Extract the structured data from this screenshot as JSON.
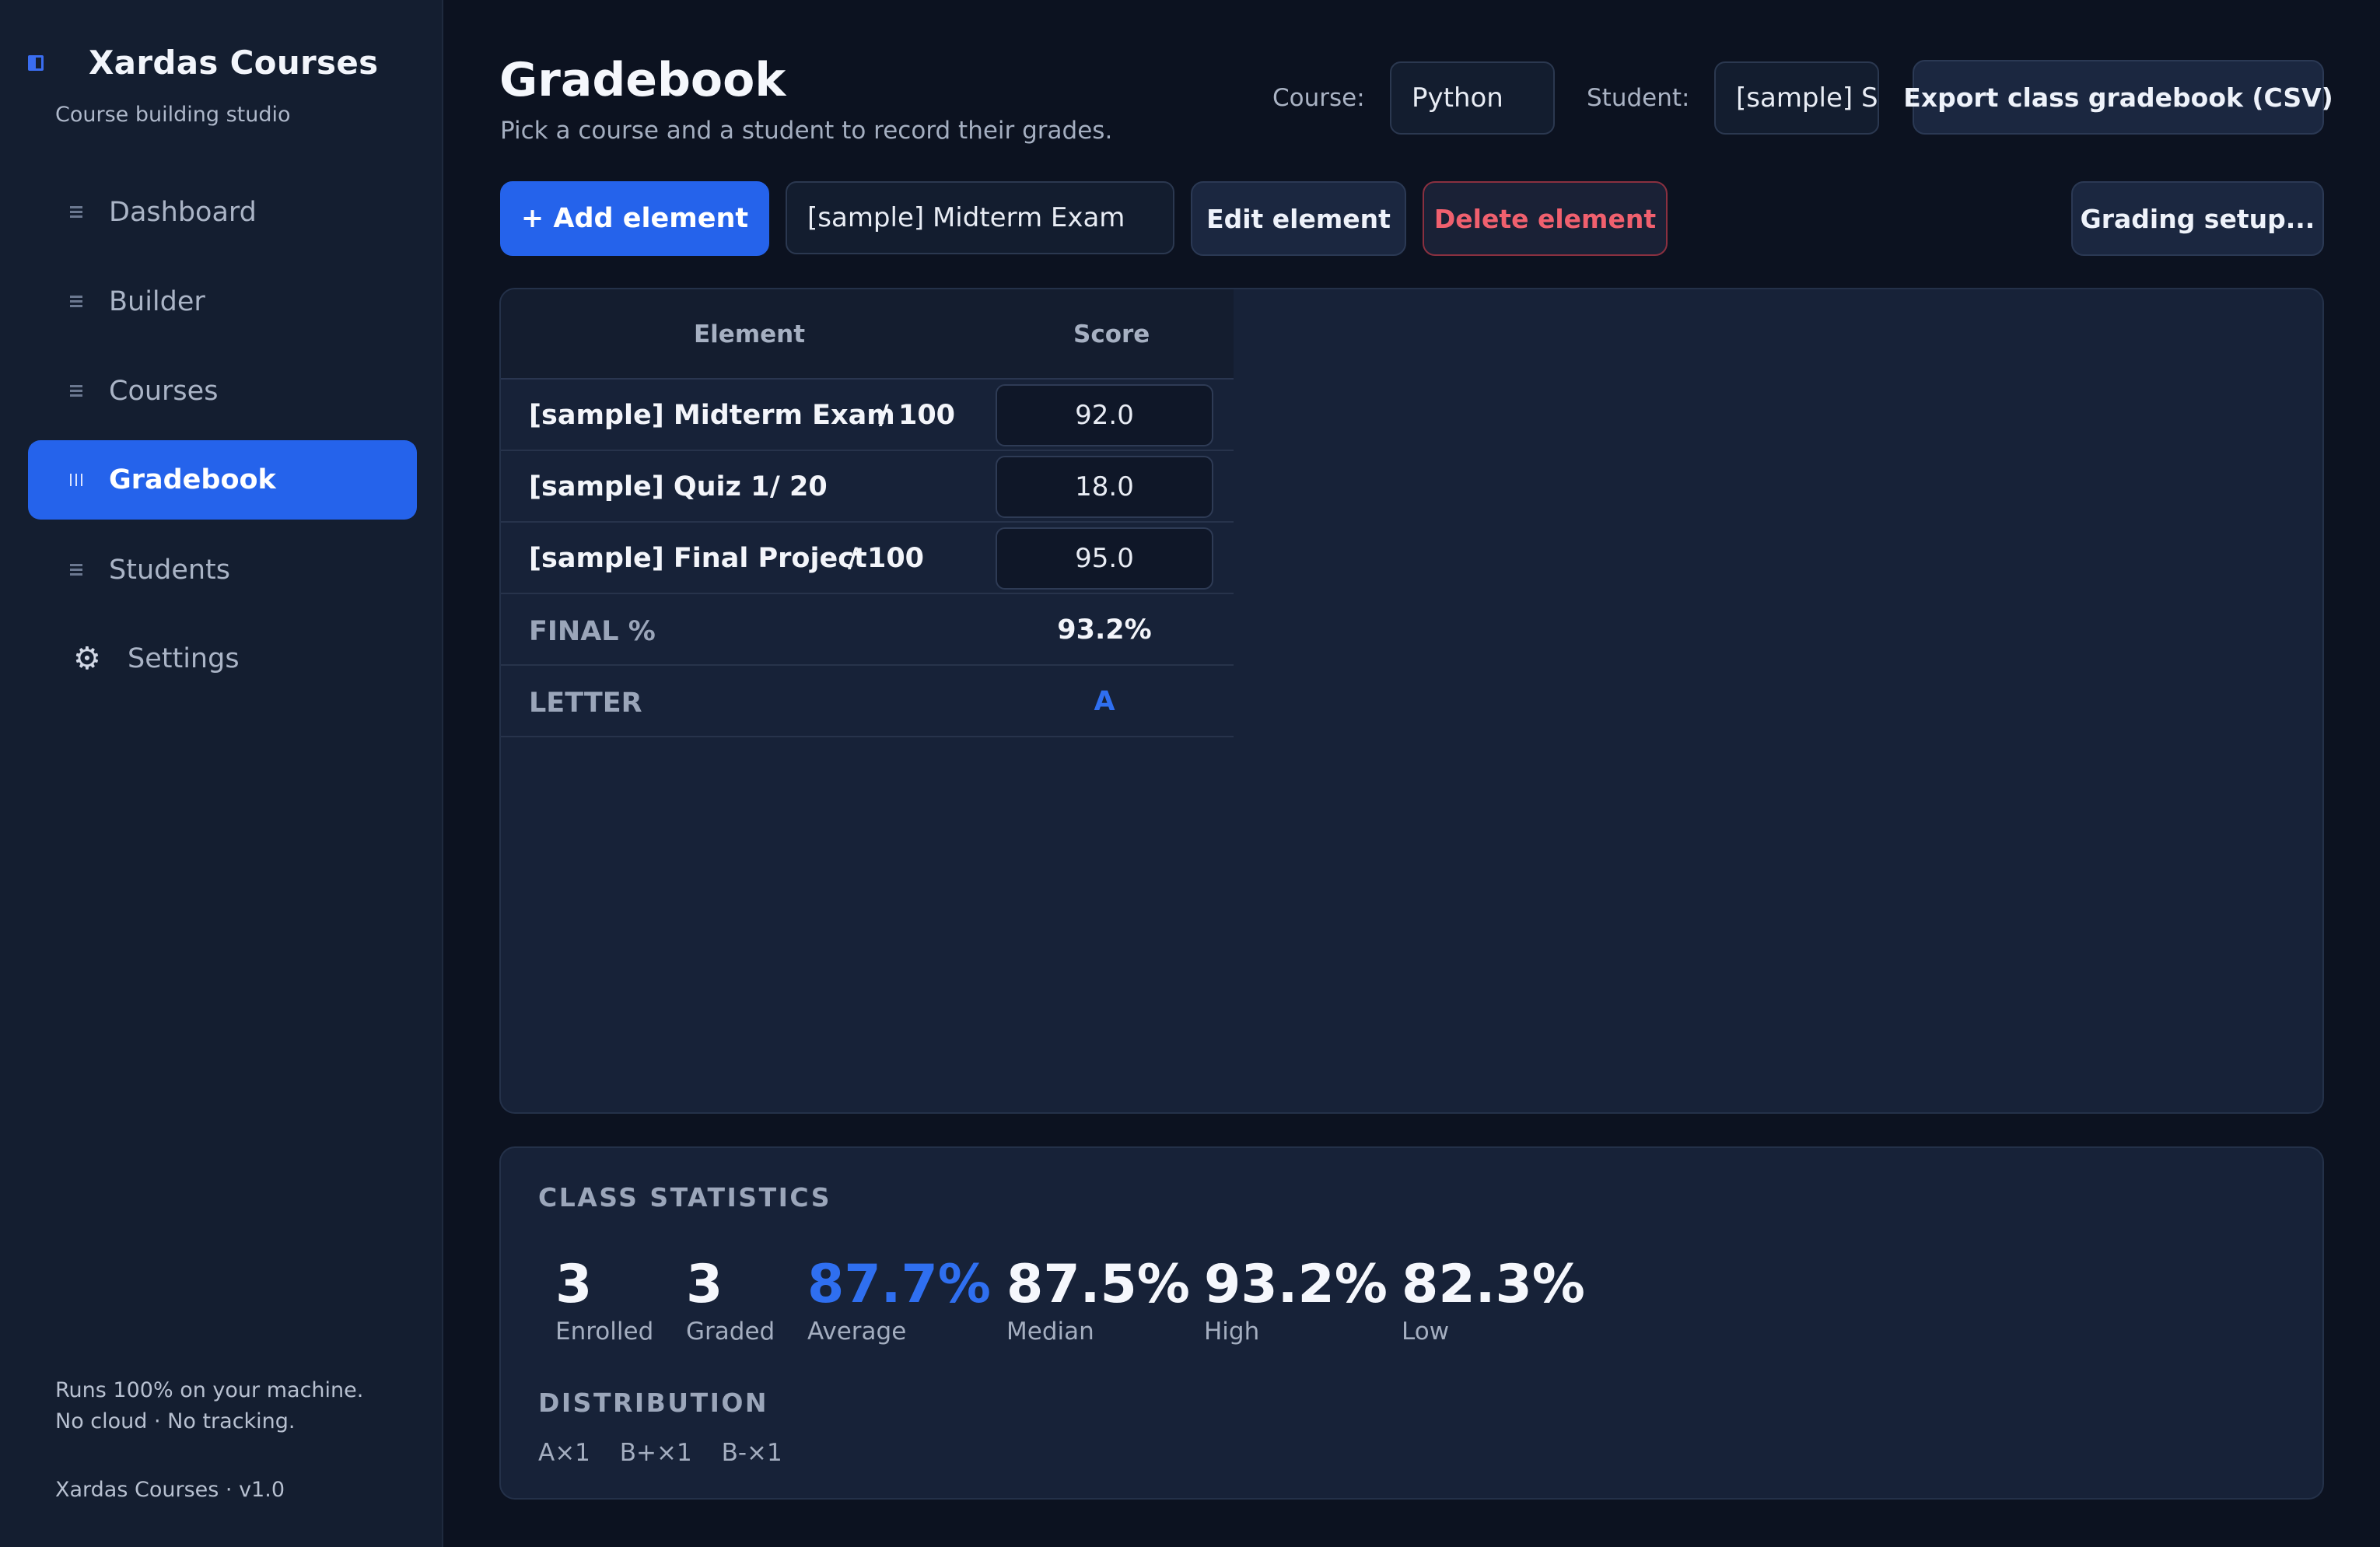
{
  "sidebar": {
    "brand_title": "Xardas Courses",
    "brand_subtitle": "Course building studio",
    "items": [
      {
        "label": "Dashboard",
        "icon": "list-icon"
      },
      {
        "label": "Builder",
        "icon": "list-icon"
      },
      {
        "label": "Courses",
        "icon": "list-icon"
      },
      {
        "label": "Gradebook",
        "icon": "columns-icon",
        "active": true
      },
      {
        "label": "Students",
        "icon": "list-icon"
      },
      {
        "label": "Settings",
        "icon": "gear-icon"
      }
    ],
    "footer_line1": "Runs 100% on your machine.",
    "footer_line2": "No cloud · No tracking.",
    "version": "Xardas Courses · v1.0"
  },
  "header": {
    "title": "Gradebook",
    "subtitle": "Pick a course and a student to record their grades.",
    "course_label": "Course:",
    "course_value": "Python",
    "student_label": "Student:",
    "student_value": "[sample] Student",
    "export_label": "Export class gradebook (CSV)"
  },
  "toolbar": {
    "add_label": "+  Add element",
    "element_select_value": "[sample] Midterm Exam",
    "edit_label": "Edit element",
    "delete_label": "Delete element",
    "grading_setup_label": "Grading setup..."
  },
  "grades": {
    "col_element": "Element",
    "col_score": "Score",
    "rows": [
      {
        "name": "[sample] Midterm Exam",
        "max": "/ 100",
        "score": "92.0"
      },
      {
        "name": "[sample] Quiz 1",
        "max": "/ 20",
        "score": "18.0"
      },
      {
        "name": "[sample] Final Project",
        "max": "/ 100",
        "score": "95.0"
      }
    ],
    "final_label": "FINAL %",
    "final_value": "93.2%",
    "letter_label": "LETTER",
    "letter_value": "A"
  },
  "stats": {
    "title": "CLASS STATISTICS",
    "items": [
      {
        "value": "3",
        "label": "Enrolled"
      },
      {
        "value": "3",
        "label": "Graded"
      },
      {
        "value": "87.7%",
        "label": "Average"
      },
      {
        "value": "87.5%",
        "label": "Median"
      },
      {
        "value": "93.2%",
        "label": "High"
      },
      {
        "value": "82.3%",
        "label": "Low"
      }
    ],
    "distribution_title": "DISTRIBUTION",
    "distribution": [
      "A×1",
      "B+×1",
      "B-×1"
    ]
  },
  "colors": {
    "accent": "#2563eb",
    "background": "#0c1220",
    "panel": "#172238",
    "danger": "#f0606e"
  }
}
